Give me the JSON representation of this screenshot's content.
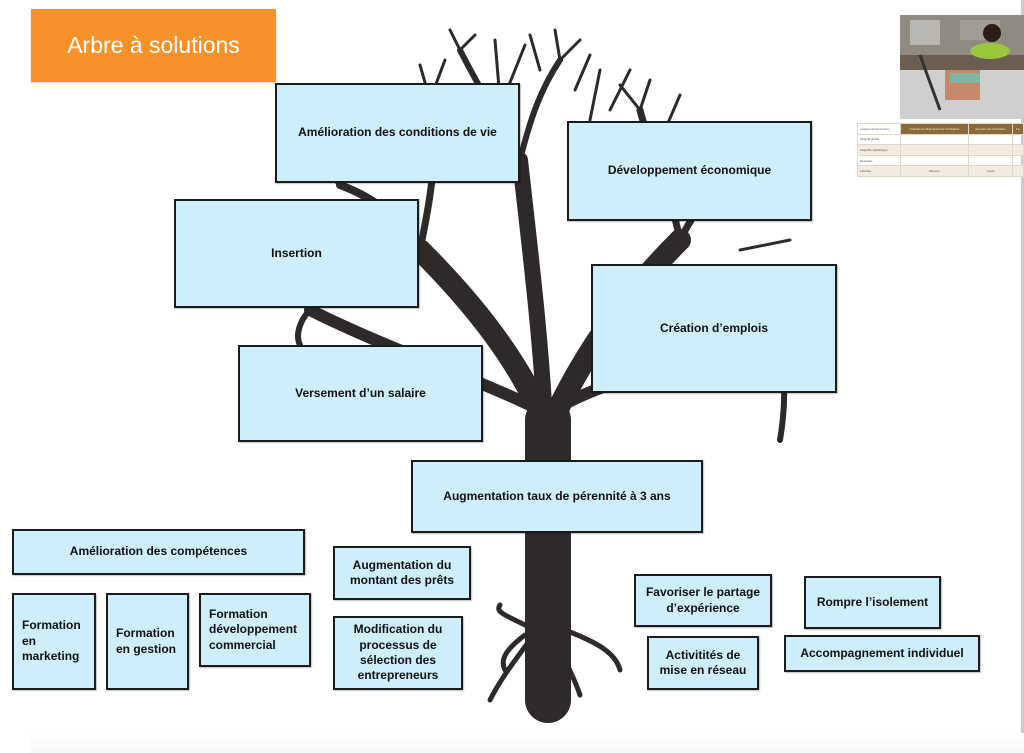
{
  "title": "Arbre à solutions",
  "colors": {
    "banner": "#f7922a",
    "box_fill": "#cdeefa",
    "box_border": "#1b1b1b",
    "tree": "#2f2a2a"
  },
  "crown": {
    "top": "Amélioration des conditions de vie",
    "economic": "Développement économique",
    "insertion": "Insertion",
    "jobs": "Création d’emplois",
    "salary": "Versement d’un salaire"
  },
  "trunk": "Augmentation taux de pérennité à 3 ans",
  "roots": {
    "skills": "Amélioration des compétences",
    "training_marketing": "Formation en marketing",
    "training_management": "Formation en gestion",
    "training_commercial": "Formation développement commercial",
    "loan_amount": "Augmentation du montant des prêts",
    "selection_process": "Modification du processus de sélection des entrepreneurs",
    "share_experience": "Favoriser le partage d’expérience",
    "networking": "Activitités de mise en réseau",
    "isolation": "Rompre l’isolement",
    "coaching": "Accompagnement individuel"
  },
  "thumbnail_table": {
    "headers": [
      "Logique d'intervention",
      "Indicateurs Objectivement Vérifiables",
      "Sources de vérification",
      "Hy"
    ],
    "rows": [
      [
        "Objectif global",
        "",
        "",
        ""
      ],
      [
        "Objectifs spécifiques",
        "",
        "",
        ""
      ],
      [
        "Résultats",
        "",
        "",
        ""
      ],
      [
        "Activités",
        "Moyens",
        "Coûts",
        ""
      ]
    ]
  }
}
